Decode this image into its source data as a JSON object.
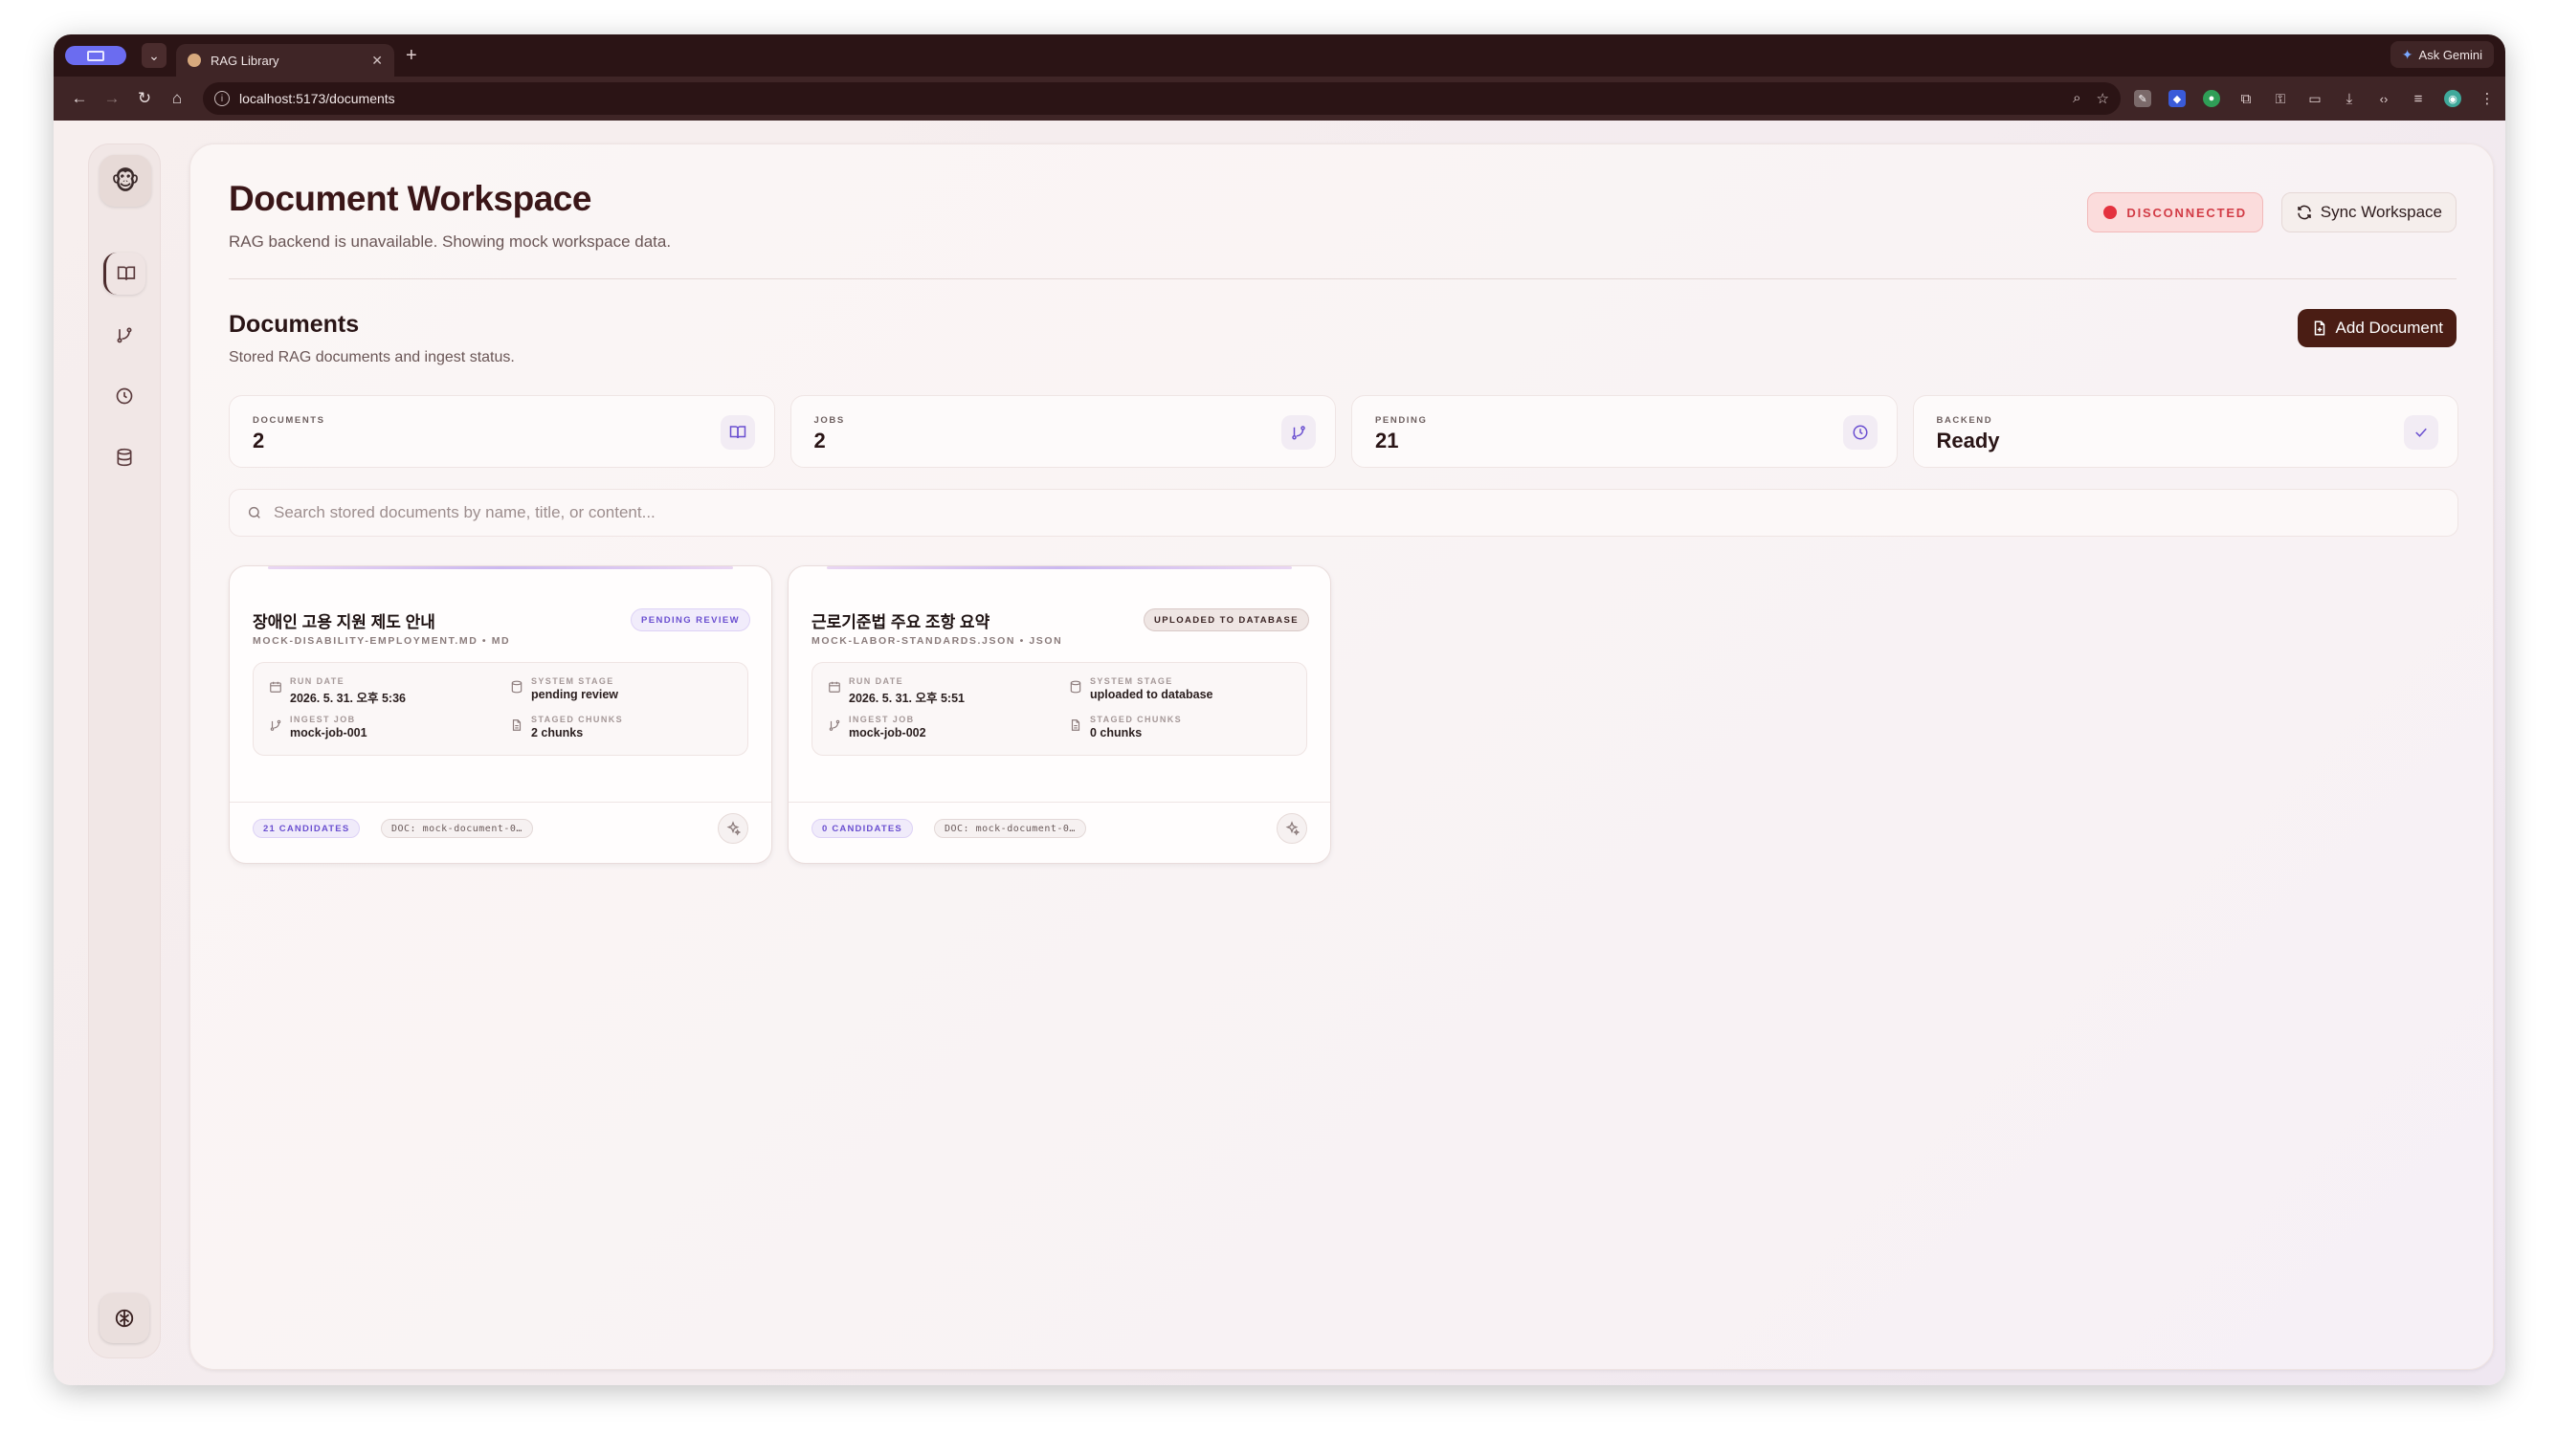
{
  "browser": {
    "tab_title": "RAG Library",
    "url": "localhost:5173/documents",
    "ask_gemini": "Ask Gemini"
  },
  "header": {
    "title": "Document Workspace",
    "subtitle": "RAG backend is unavailable. Showing mock workspace data.",
    "status_badge": "DISCONNECTED",
    "sync_button": "Sync Workspace"
  },
  "section": {
    "title": "Documents",
    "subtitle": "Stored RAG documents and ingest status.",
    "add_button": "Add Document"
  },
  "stats": [
    {
      "label": "DOCUMENTS",
      "value": "2",
      "icon": "book-icon"
    },
    {
      "label": "JOBS",
      "value": "2",
      "icon": "branch-icon"
    },
    {
      "label": "PENDING",
      "value": "21",
      "icon": "clock-icon"
    },
    {
      "label": "BACKEND",
      "value": "Ready",
      "icon": "check-icon"
    }
  ],
  "search": {
    "placeholder": "Search stored documents by name, title, or content..."
  },
  "documents": [
    {
      "title": "장애인 고용 지원 제도 안내",
      "meta": "MOCK-DISABILITY-EMPLOYMENT.MD • MD",
      "status": "PENDING REVIEW",
      "run_date_label": "RUN DATE",
      "run_date": "2026. 5. 31. 오후 5:36",
      "stage_label": "SYSTEM STAGE",
      "stage": "pending review",
      "job_label": "INGEST JOB",
      "job": "mock-job-001",
      "chunks_label": "STAGED CHUNKS",
      "chunks": "2 chunks",
      "candidates": "21 CANDIDATES",
      "doc_chip": "DOC: mock-document-0…"
    },
    {
      "title": "근로기준법 주요 조항 요약",
      "meta": "MOCK-LABOR-STANDARDS.JSON • JSON",
      "status": "UPLOADED TO DATABASE",
      "run_date_label": "RUN DATE",
      "run_date": "2026. 5. 31. 오후 5:51",
      "stage_label": "SYSTEM STAGE",
      "stage": "uploaded to database",
      "job_label": "INGEST JOB",
      "job": "mock-job-002",
      "chunks_label": "STAGED CHUNKS",
      "chunks": "0 chunks",
      "candidates": "0 CANDIDATES",
      "doc_chip": "DOC: mock-document-0…"
    }
  ],
  "colors": {
    "accent_dark": "#4a1d14",
    "danger": "#e4323f",
    "violet": "#6a4fd0"
  }
}
